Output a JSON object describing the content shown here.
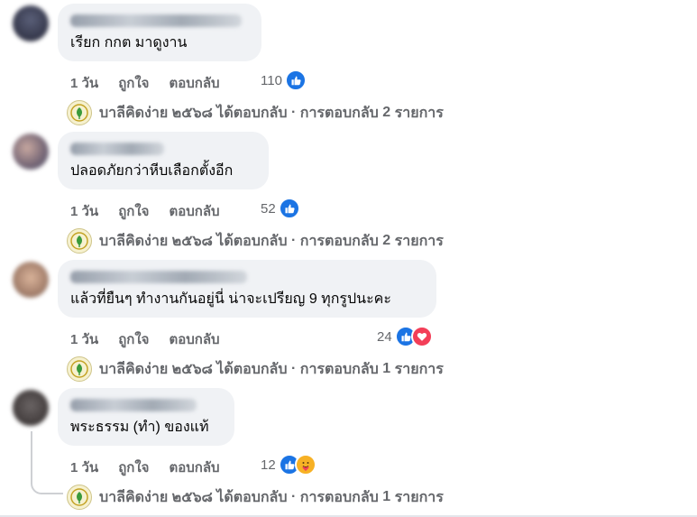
{
  "actions": {
    "time": "1 วัน",
    "like": "ถูกใจ",
    "reply": "ตอบกลับ"
  },
  "page_reply": {
    "page_name": "บาลีคิดง่าย ๒๕๖๘",
    "replied": "ได้ตอบกลับ",
    "separator": "·",
    "replies_prefix": "การตอบกลับ",
    "unit": "รายการ"
  },
  "comments": [
    {
      "text": "เรียก กกต มาดูงาน",
      "reaction_count": "110",
      "reactions": [
        "like"
      ],
      "reply_count": "2"
    },
    {
      "text": "ปลอดภัยกว่าหีบเลือกตั้งอีก",
      "reaction_count": "52",
      "reactions": [
        "like"
      ],
      "reply_count": "2"
    },
    {
      "text": "แล้วที่ยืนๆ ทำงานกันอยู่นี่ น่าจะเปรียญ 9 ทุกรูปนะคะ",
      "reaction_count": "24",
      "reactions": [
        "like",
        "love"
      ],
      "reply_count": "1"
    },
    {
      "text": "พระธรรม (ทำ) ของแท้",
      "reaction_count": "12",
      "reactions": [
        "like",
        "care"
      ],
      "reply_count": "1"
    }
  ],
  "colors": {
    "like": "#1b74e4",
    "love": "#f33e58",
    "care": "#f7b125",
    "bubble": "#f0f2f5",
    "meta_text": "#65676b"
  }
}
